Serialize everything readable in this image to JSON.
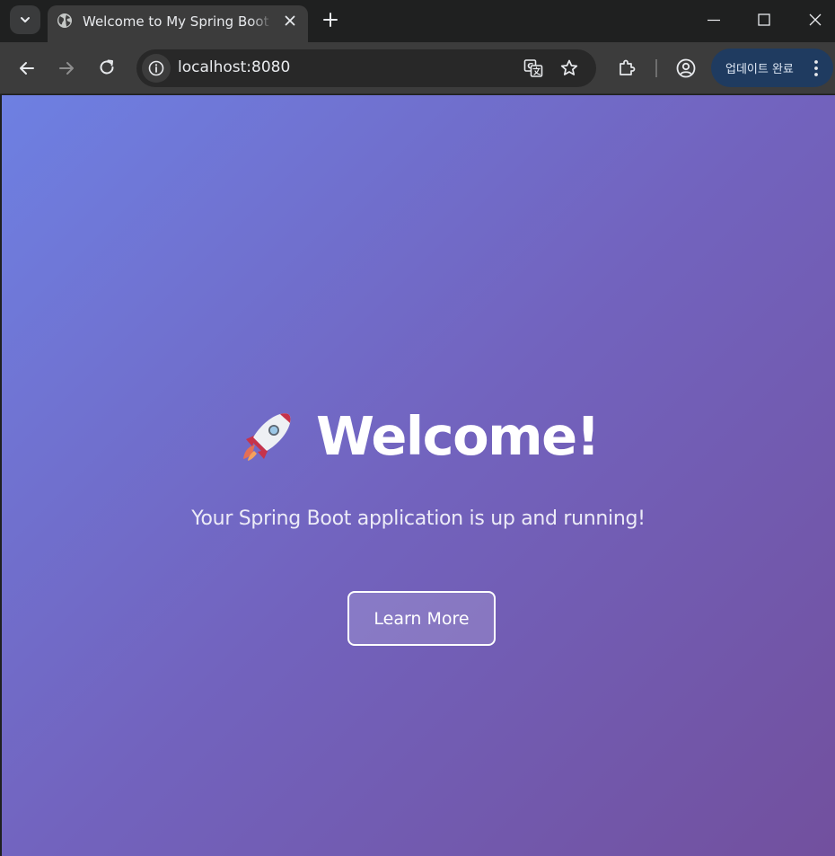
{
  "browser": {
    "tab": {
      "title": "Welcome to My Spring Boot Application"
    },
    "address_bar": {
      "url": "localhost:8080"
    },
    "update_chip": {
      "label": "업데이트 완료"
    },
    "colors": {
      "frame": "#1f2020",
      "toolbar": "#3c3c3c",
      "omnibox": "#282828",
      "update_chip": "#1f3b60"
    }
  },
  "page": {
    "hero": {
      "emoji_icon": "rocket-icon",
      "title": "Welcome!",
      "subtitle": "Your Spring Boot application is up and running!"
    },
    "cta": {
      "label": "Learn More"
    },
    "colors": {
      "gradient_start": "#6e80e2",
      "gradient_mid": "#7263be",
      "gradient_end": "#72509e",
      "text": "#ffffff"
    }
  }
}
